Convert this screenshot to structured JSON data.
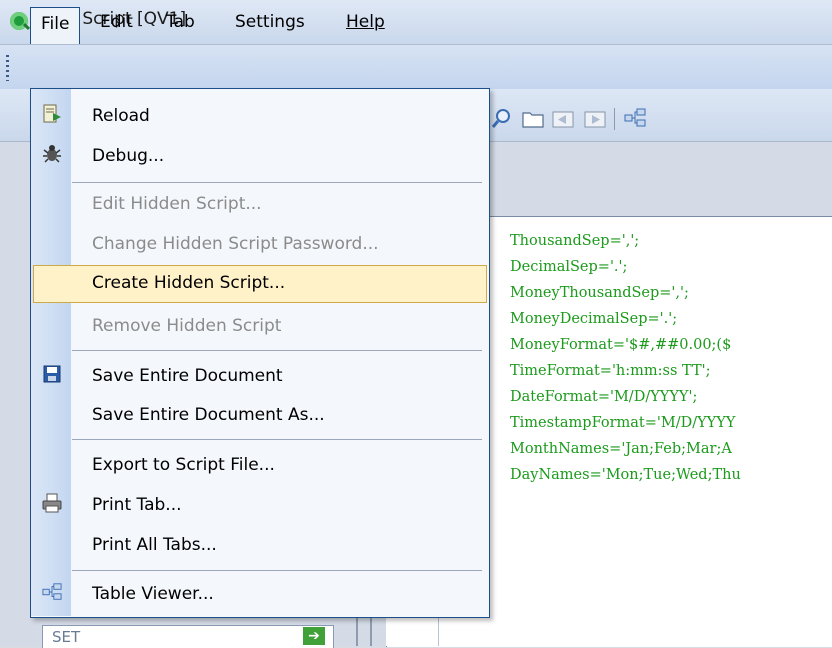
{
  "window": {
    "title": "Edit Script [QV1]"
  },
  "menubar": {
    "items": [
      {
        "label": "File"
      },
      {
        "label": "Edit"
      },
      {
        "label": "Tab"
      },
      {
        "label": "Settings"
      },
      {
        "label": "Help"
      }
    ]
  },
  "toolbar": {
    "icons": [
      "search-icon",
      "folder-icon",
      "back-icon",
      "forward-icon",
      "table-viewer-icon"
    ]
  },
  "file_menu": {
    "reload": "Reload",
    "debug": "Debug...",
    "edit_hidden": "Edit Hidden Script...",
    "change_hidden_password": "Change Hidden Script Password...",
    "create_hidden": "Create Hidden Script...",
    "remove_hidden": "Remove Hidden Script",
    "save_entire": "Save Entire Document",
    "save_entire_as": "Save Entire Document As...",
    "export_script": "Export to Script File...",
    "print_tab": "Print Tab...",
    "print_all_tabs": "Print All Tabs...",
    "table_viewer": "Table Viewer..."
  },
  "editor": {
    "lines": [
      "ThousandSep=',';",
      "DecimalSep='.';",
      "MoneyThousandSep=',';",
      "MoneyDecimalSep='.';",
      "MoneyFormat='$#,##0.00;($",
      "TimeFormat='h:mm:ss TT';",
      "DateFormat='M/D/YYYY';",
      "TimestampFormat='M/D/YYYY",
      "MonthNames='Jan;Feb;Mar;A",
      "DayNames='Mon;Tue;Wed;Thu"
    ]
  },
  "left_pane": {
    "set_label": "SET"
  },
  "colors": {
    "menu_border": "#1c4e8a",
    "highlight_bg": "#fff2c8",
    "code_green": "#1b9a1b",
    "keyword_blue": "#1c4dbf"
  }
}
